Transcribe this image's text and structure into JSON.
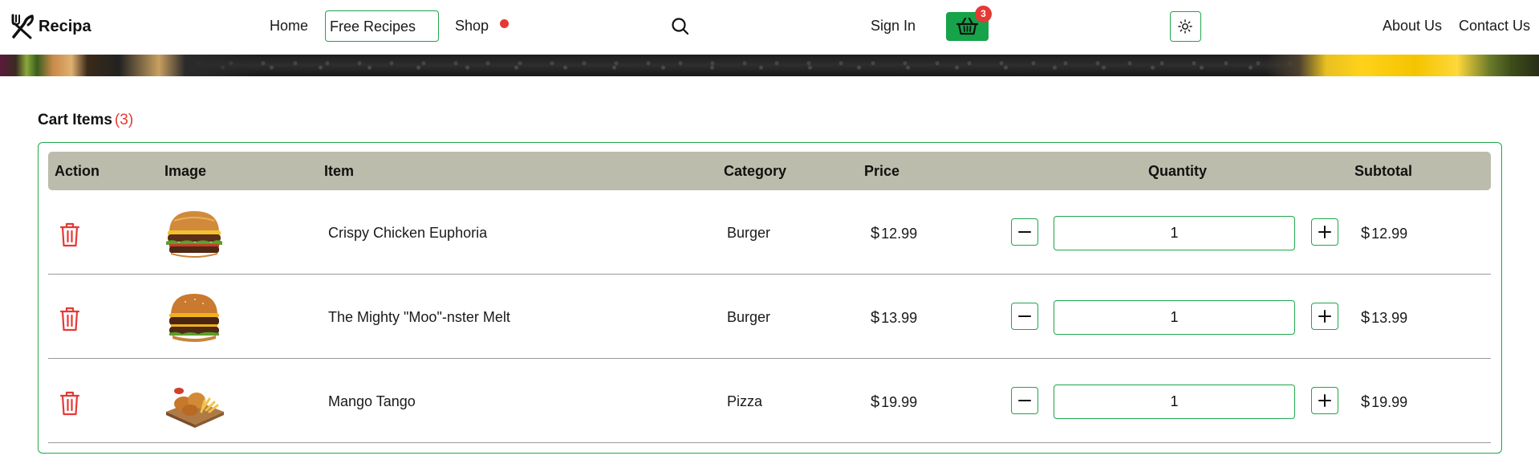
{
  "brand": {
    "name": "Recipa",
    "icon": "utensils-crossed-icon"
  },
  "nav": {
    "home": "Home",
    "free_recipes": "Free Recipes",
    "shop": "Shop",
    "sign_in": "Sign In",
    "cart_count": "3",
    "about": "About Us",
    "contact": "Contact Us",
    "search_icon": "search-icon",
    "theme_icon": "sun-icon"
  },
  "colors": {
    "accent_green": "#16a34a",
    "border_green": "#1fa64c",
    "badge_red": "#e53935",
    "table_header_bg": "#bbbcab"
  },
  "cart": {
    "title": "Cart Items",
    "count": "(3)",
    "headers": {
      "action": "Action",
      "image": "Image",
      "item": "Item",
      "category": "Category",
      "price": "Price",
      "quantity": "Quantity",
      "subtotal": "Subtotal"
    },
    "currency": "$",
    "items": [
      {
        "name": "Crispy Chicken Euphoria",
        "category": "Burger",
        "price": "12.99",
        "quantity": "1",
        "subtotal": "12.99",
        "image": "burger-image"
      },
      {
        "name": "The Mighty \"Moo\"-nster Melt",
        "category": "Burger",
        "price": "13.99",
        "quantity": "1",
        "subtotal": "13.99",
        "image": "burger-image"
      },
      {
        "name": "Mango Tango",
        "category": "Pizza",
        "price": "19.99",
        "quantity": "1",
        "subtotal": "19.99",
        "image": "fried-chicken-image"
      }
    ]
  }
}
